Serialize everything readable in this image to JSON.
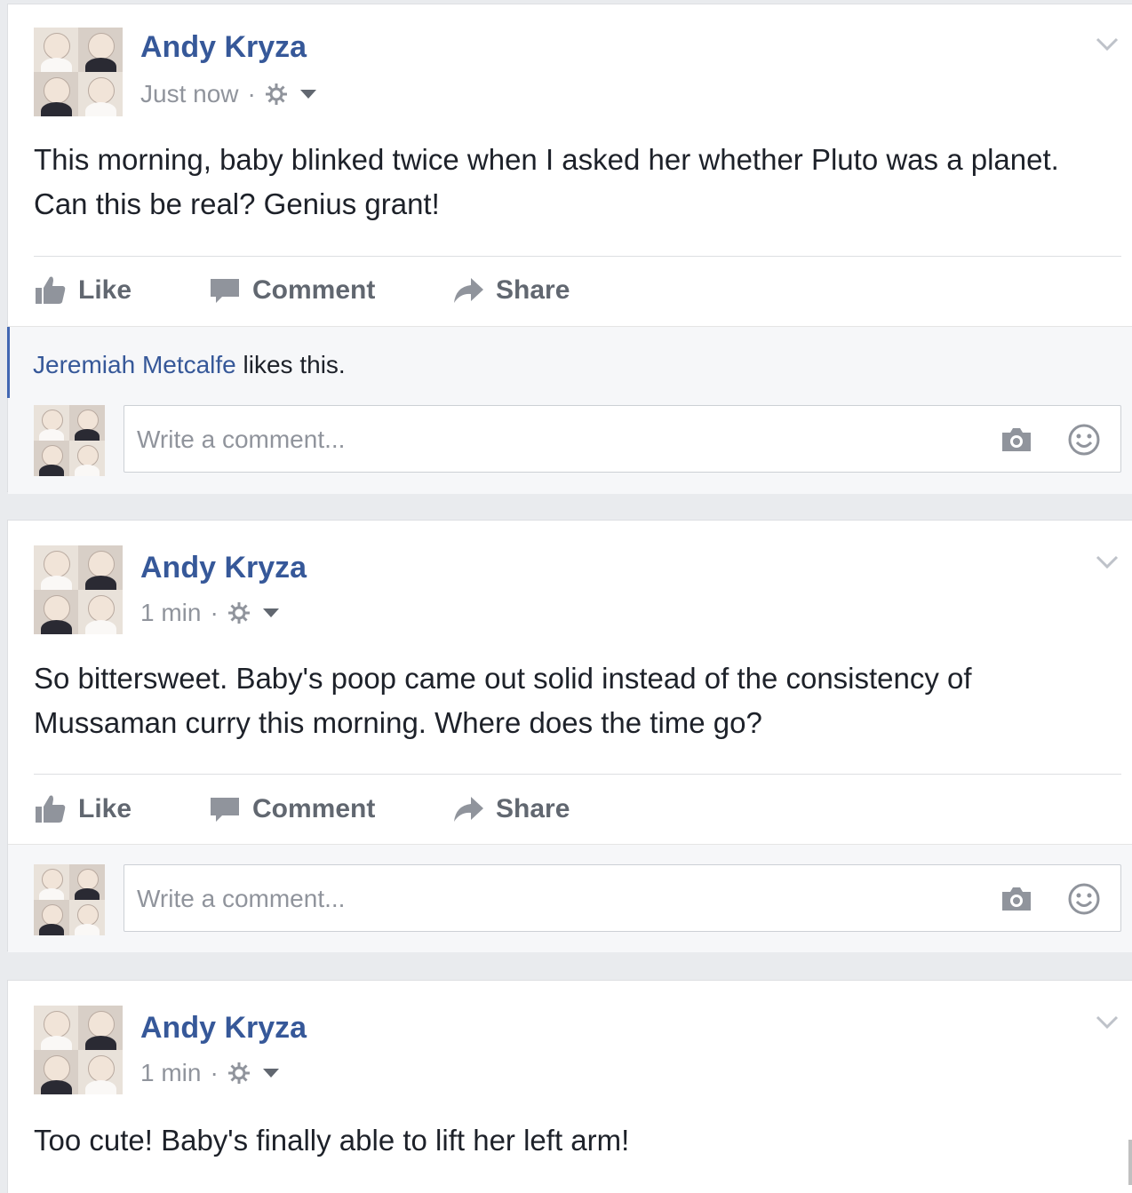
{
  "posts": [
    {
      "author": "Andy Kryza",
      "timestamp": "Just now",
      "separator": "·",
      "privacy_icon": "friends-gear-icon",
      "text": "This morning, baby blinked twice when I asked her whether Pluto was a planet. Can this be real? Genius grant!",
      "actions": {
        "like": "Like",
        "comment": "Comment",
        "share": "Share"
      },
      "likes": {
        "name": "Jeremiah Metcalfe",
        "suffix": " likes this."
      },
      "comment_placeholder": "Write a comment..."
    },
    {
      "author": "Andy Kryza",
      "timestamp": "1 min",
      "separator": "·",
      "privacy_icon": "friends-gear-icon",
      "text": "So bittersweet. Baby's poop came out solid instead of the consistency of Mussaman curry this morning. Where does the time go?",
      "actions": {
        "like": "Like",
        "comment": "Comment",
        "share": "Share"
      },
      "comment_placeholder": "Write a comment..."
    },
    {
      "author": "Andy Kryza",
      "timestamp": "1 min",
      "separator": "·",
      "privacy_icon": "friends-gear-icon",
      "text": "Too cute! Baby's finally able to lift her left arm!"
    }
  ],
  "colors": {
    "link": "#365899",
    "meta": "#90949c",
    "action": "#616770",
    "feed_bg": "#e9ebee",
    "accent": "#4267b2"
  }
}
